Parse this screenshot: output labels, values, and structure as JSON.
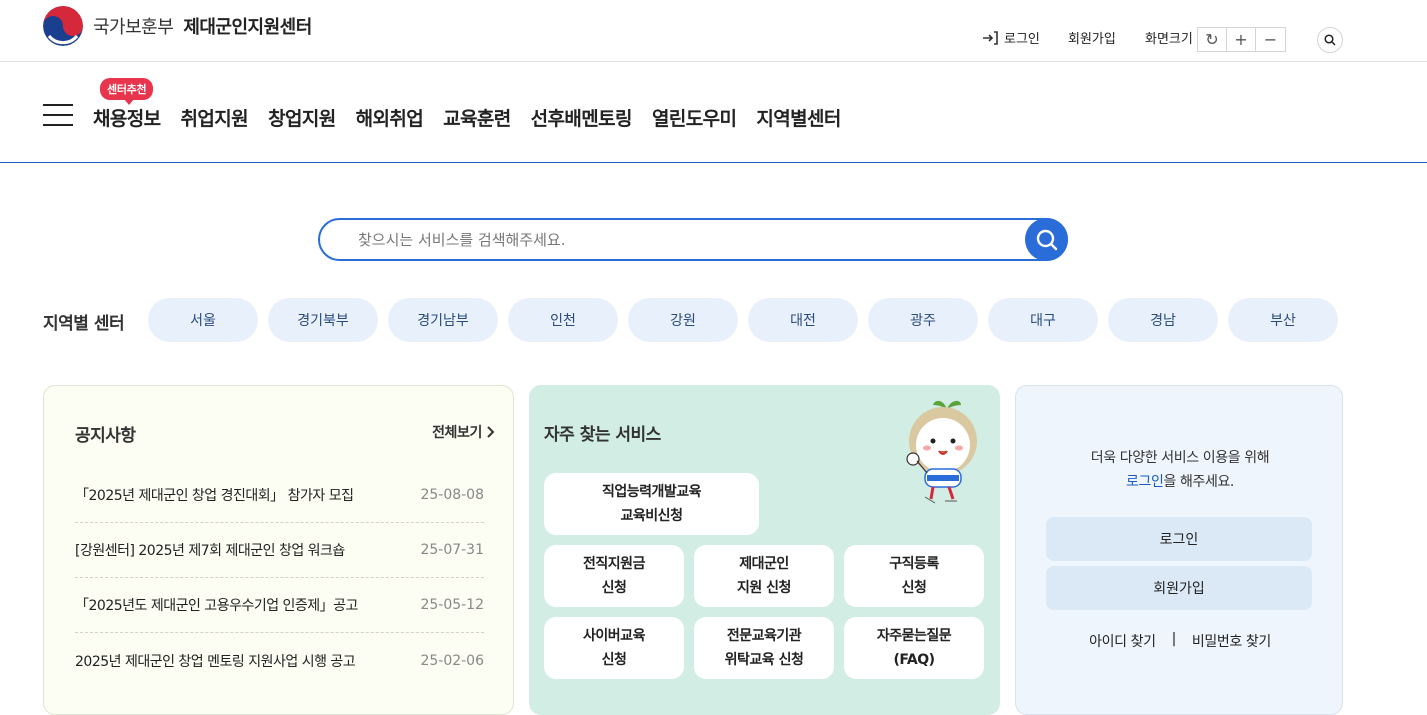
{
  "header": {
    "ministry": "국가보훈부",
    "center": "제대군인지원센터",
    "login": "로그인",
    "join": "회원가입",
    "zoom_label": "화면크기",
    "zoom_reset": "↻",
    "zoom_in": "+",
    "zoom_out": "−"
  },
  "nav": {
    "badge": "센터추천",
    "items": [
      "채용정보",
      "취업지원",
      "창업지원",
      "해외취업",
      "교육훈련",
      "선후배멘토링",
      "열린도우미",
      "지역별센터"
    ]
  },
  "search": {
    "placeholder": "찾으시는 서비스를 검색해주세요."
  },
  "regions": {
    "label": "지역별 센터",
    "items": [
      "서울",
      "경기북부",
      "경기남부",
      "인천",
      "강원",
      "대전",
      "광주",
      "대구",
      "경남",
      "부산"
    ]
  },
  "notice": {
    "title": "공지사항",
    "more": "전체보기",
    "rows": [
      {
        "text": "「2025년 제대군인 창업 경진대회」 참가자 모집",
        "date": "25-08-08"
      },
      {
        "text": "[강원센터] 2025년 제7회 제대군인 창업 워크숍",
        "date": "25-07-31"
      },
      {
        "text": "「2025년도 제대군인 고용우수기업 인증제」공고",
        "date": "25-05-12"
      },
      {
        "text": "2025년 제대군인 창업 멘토링 지원사업 시행 공고",
        "date": "25-02-06"
      }
    ]
  },
  "services": {
    "title": "자주 찾는 서비스",
    "items": [
      {
        "l1": "직업능력개발교육",
        "l2": "교육비신청"
      },
      {
        "l1": "전직지원금",
        "l2": "신청"
      },
      {
        "l1": "제대군인",
        "l2": "지원 신청"
      },
      {
        "l1": "구직등록",
        "l2": "신청"
      },
      {
        "l1": "사이버교육",
        "l2": "신청"
      },
      {
        "l1": "전문교육기관",
        "l2": "위탁교육 신청"
      },
      {
        "l1": "자주묻는질문",
        "l2": "(FAQ)"
      }
    ]
  },
  "login_box": {
    "msg1": "더욱 다양한 서비스 이용을 위해",
    "msg2_link": "로그인",
    "msg2_rest": "을 해주세요.",
    "login_btn": "로그인",
    "join_btn": "회원가입",
    "find_id": "아이디 찾기",
    "sep": "|",
    "find_pw": "비밀번호 찾기"
  },
  "colors": {
    "accent": "#2a6dd8",
    "badge": "#e8344d",
    "services_bg": "#d2ede4",
    "login_bg": "#eef5fc"
  }
}
